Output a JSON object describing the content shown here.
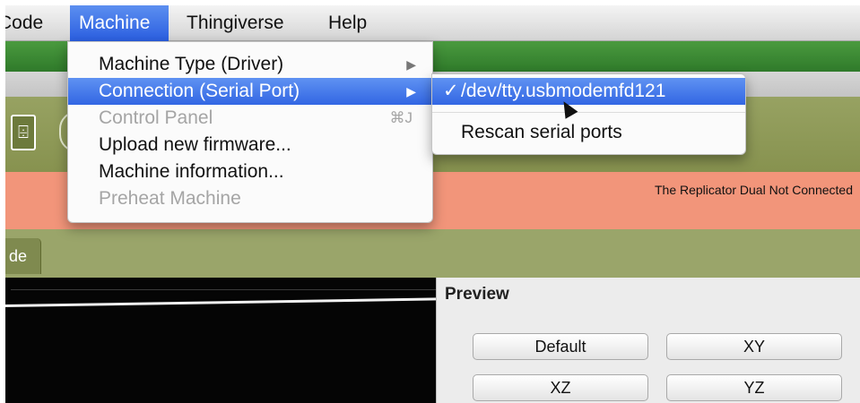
{
  "menubar": {
    "items": [
      {
        "label": "Code"
      },
      {
        "label": "Machine"
      },
      {
        "label": "Thingiverse"
      },
      {
        "label": "Help"
      }
    ]
  },
  "machine_menu": {
    "items": [
      {
        "label": "Machine Type (Driver)",
        "arrow": "▶"
      },
      {
        "label": "Connection (Serial Port)",
        "arrow": "▶"
      },
      {
        "label": "Control Panel",
        "shortcut": "⌘J"
      },
      {
        "label": "Upload new firmware..."
      },
      {
        "label": "Machine information..."
      },
      {
        "label": "Preheat Machine"
      }
    ]
  },
  "serial_submenu": {
    "check": "✓",
    "port": "/dev/tty.usbmodemfd121",
    "rescan": "Rescan serial ports"
  },
  "status": {
    "text": "The Replicator Dual Not Connected"
  },
  "tab": {
    "label": "de"
  },
  "preview": {
    "title": "Preview",
    "buttons": {
      "default": "Default",
      "xy": "XY",
      "xz": "XZ",
      "yz": "YZ"
    }
  },
  "colors": {
    "highlight": "#3266e3",
    "status_band": "#f2957a",
    "toolbar_green": "#2f7a2a",
    "toolbar_olive": "#87924f"
  }
}
